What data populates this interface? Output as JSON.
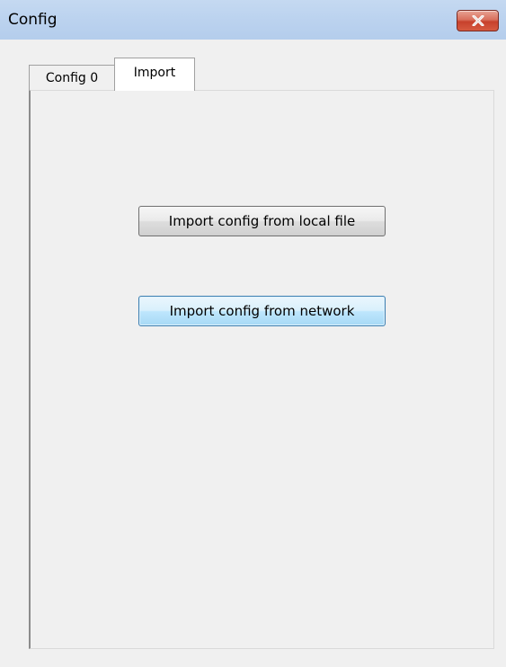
{
  "window": {
    "title": "Config"
  },
  "icons": {
    "close": "close-icon"
  },
  "tabs": [
    {
      "label": "Config 0",
      "selected": false
    },
    {
      "label": "Import",
      "selected": true
    }
  ],
  "import_panel": {
    "local_button_label": "Import config from local file",
    "network_button_label": "Import config from network"
  },
  "colors": {
    "titlebar": "#bcd3ef",
    "close_button": "#c7412c",
    "focused_button_border": "#3c7fb1",
    "window_background": "#f0f0f0"
  }
}
